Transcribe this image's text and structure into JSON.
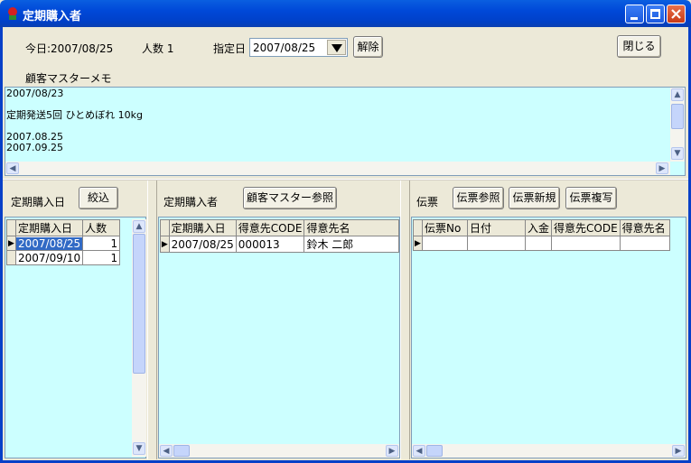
{
  "window": {
    "title": "定期購入者"
  },
  "header": {
    "today_label": "今日:2007/08/25",
    "count_label": "人数 1",
    "date_label": "指定日",
    "date_value": "2007/08/25",
    "clear_button": "解除",
    "close_button": "閉じる",
    "memo_label": "顧客マスターメモ"
  },
  "memo": {
    "lines": [
      "2007/08/23",
      "",
      "定期発送5回 ひとめぼれ 10kg",
      "",
      "2007.08.25",
      "2007.09.25"
    ]
  },
  "left_pane": {
    "label": "定期購入日",
    "filter_button": "絞込",
    "columns": [
      "定期購入日",
      "人数"
    ],
    "rows": [
      {
        "date": "2007/08/25",
        "count": "1"
      },
      {
        "date": "2007/09/10",
        "count": "1"
      }
    ]
  },
  "middle_pane": {
    "label": "定期購入者",
    "ref_button": "顧客マスター参照",
    "columns": [
      "定期購入日",
      "得意先CODE",
      "得意先名"
    ],
    "rows": [
      {
        "date": "2007/08/25",
        "code": "000013",
        "name": "鈴木 二郎"
      }
    ]
  },
  "right_pane": {
    "label": "伝票",
    "ref_button": "伝票参照",
    "new_button": "伝票新規",
    "copy_button": "伝票複写",
    "columns": [
      "伝票No",
      "日付",
      "入金",
      "得意先CODE",
      "得意先名"
    ]
  }
}
